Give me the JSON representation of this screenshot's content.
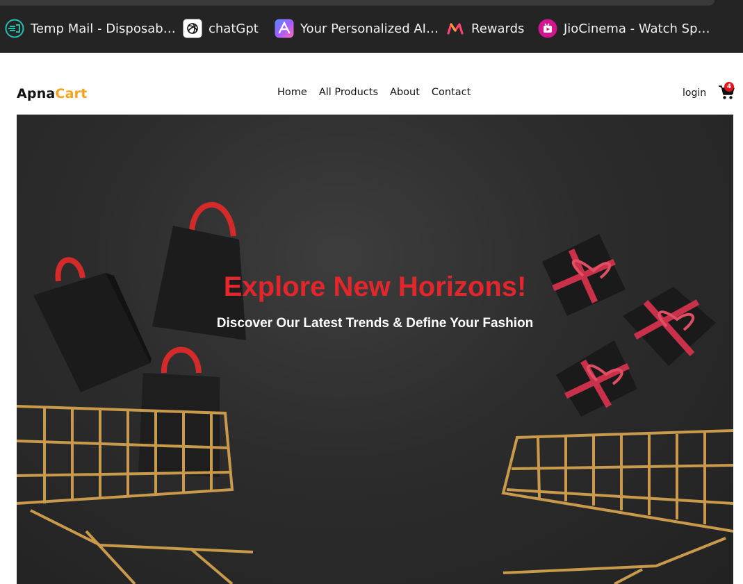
{
  "browser": {
    "bookmarks": [
      {
        "label": "Temp Mail - Disposab…",
        "icon": "temp-mail-icon"
      },
      {
        "label": "chatGpt",
        "icon": "chatgpt-icon"
      },
      {
        "label": "Your Personalized AI…",
        "icon": "ai-assistant-icon"
      },
      {
        "label": "Rewards",
        "icon": "rewards-icon"
      },
      {
        "label": "JioCinema - Watch Sp…",
        "icon": "jiocinema-icon"
      }
    ]
  },
  "site": {
    "logo": {
      "primary": "Apna",
      "accent": "Cart"
    },
    "nav": [
      "Home",
      "All Products",
      "About",
      "Contact"
    ],
    "login_label": "login",
    "cart_count": "4",
    "colors": {
      "accent": "#f5a21a",
      "hero_title": "#e3262b",
      "badge": "#e8121a"
    }
  },
  "hero": {
    "title": "Explore New Horizons!",
    "subtitle": "Discover Our Latest Trends & Define Your Fashion"
  }
}
